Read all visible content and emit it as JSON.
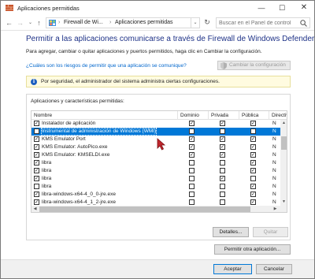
{
  "window": {
    "title": "Aplicaciones permitidas",
    "minimize": "—",
    "maximize": "☐",
    "close": "✕"
  },
  "address": {
    "back": "←",
    "forward": "→",
    "recent": "⌄",
    "up": "↑",
    "separator": "›",
    "crumbs": [
      "Firewall de Wi...",
      "Aplicaciones permitidas"
    ],
    "dropdown": "⌄",
    "refresh": "↻",
    "search_placeholder": "Buscar en el Panel de control"
  },
  "main": {
    "heading": "Permitir a las aplicaciones comunicarse a través de Firewall de Windows Defender",
    "subtext": "Para agregar, cambiar o quitar aplicaciones y puertos permitidos, haga clic en Cambiar la configuración.",
    "risk_link": "¿Cuáles son los riesgos de permitir que una aplicación se comunique?",
    "change_settings": "Cambiar la configuración",
    "info_text": "Por seguridad, el administrador del sistema administra ciertas configuraciones.",
    "info_symbol": "i",
    "group_label": "Aplicaciones y características permitidas:"
  },
  "table": {
    "columns": [
      "Nombre",
      "Dominio",
      "Privada",
      "Pública",
      "Directiva"
    ],
    "check_mark": "✓",
    "rows": [
      {
        "name": "Instalador de aplicación",
        "enabled": true,
        "domain": true,
        "private": true,
        "public": true,
        "policy": "N",
        "selected": false
      },
      {
        "name": "Instrumental de administración de Windows (WMI)",
        "enabled": false,
        "domain": false,
        "private": false,
        "public": false,
        "policy": "N",
        "selected": true
      },
      {
        "name": "KMS Emulator Port",
        "enabled": true,
        "domain": true,
        "private": true,
        "public": true,
        "policy": "N",
        "selected": false
      },
      {
        "name": "KMS Emulator: AutoPico.exe",
        "enabled": true,
        "domain": true,
        "private": true,
        "public": true,
        "policy": "N",
        "selected": false
      },
      {
        "name": "KMS Emulator: KMSELDI.exe",
        "enabled": true,
        "domain": true,
        "private": true,
        "public": true,
        "policy": "N",
        "selected": false
      },
      {
        "name": "libra",
        "enabled": true,
        "domain": false,
        "private": false,
        "public": true,
        "policy": "N",
        "selected": false
      },
      {
        "name": "libra",
        "enabled": true,
        "domain": false,
        "private": false,
        "public": true,
        "policy": "N",
        "selected": false
      },
      {
        "name": "libra",
        "enabled": true,
        "domain": false,
        "private": true,
        "public": false,
        "policy": "N",
        "selected": false
      },
      {
        "name": "libra",
        "enabled": false,
        "domain": false,
        "private": false,
        "public": true,
        "policy": "N",
        "selected": false
      },
      {
        "name": "libra-windows-x64-4_0_0-jre.exe",
        "enabled": true,
        "domain": false,
        "private": false,
        "public": true,
        "policy": "N",
        "selected": false
      },
      {
        "name": "libra-windows-x64-4_1_2-jre.exe",
        "enabled": true,
        "domain": false,
        "private": false,
        "public": true,
        "policy": "N",
        "selected": false
      }
    ]
  },
  "scroll": {
    "up": "▲",
    "down": "▼",
    "left": "◀",
    "right": "▶"
  },
  "buttons": {
    "details": "Detalles...",
    "remove": "Quitar",
    "allow_other": "Permitir otra aplicación...",
    "ok": "Aceptar",
    "cancel": "Cancelar"
  },
  "colors": {
    "selection": "#0078d7",
    "heading": "#1e3287",
    "link": "#0066cc",
    "info_bg": "#fffbe0"
  }
}
